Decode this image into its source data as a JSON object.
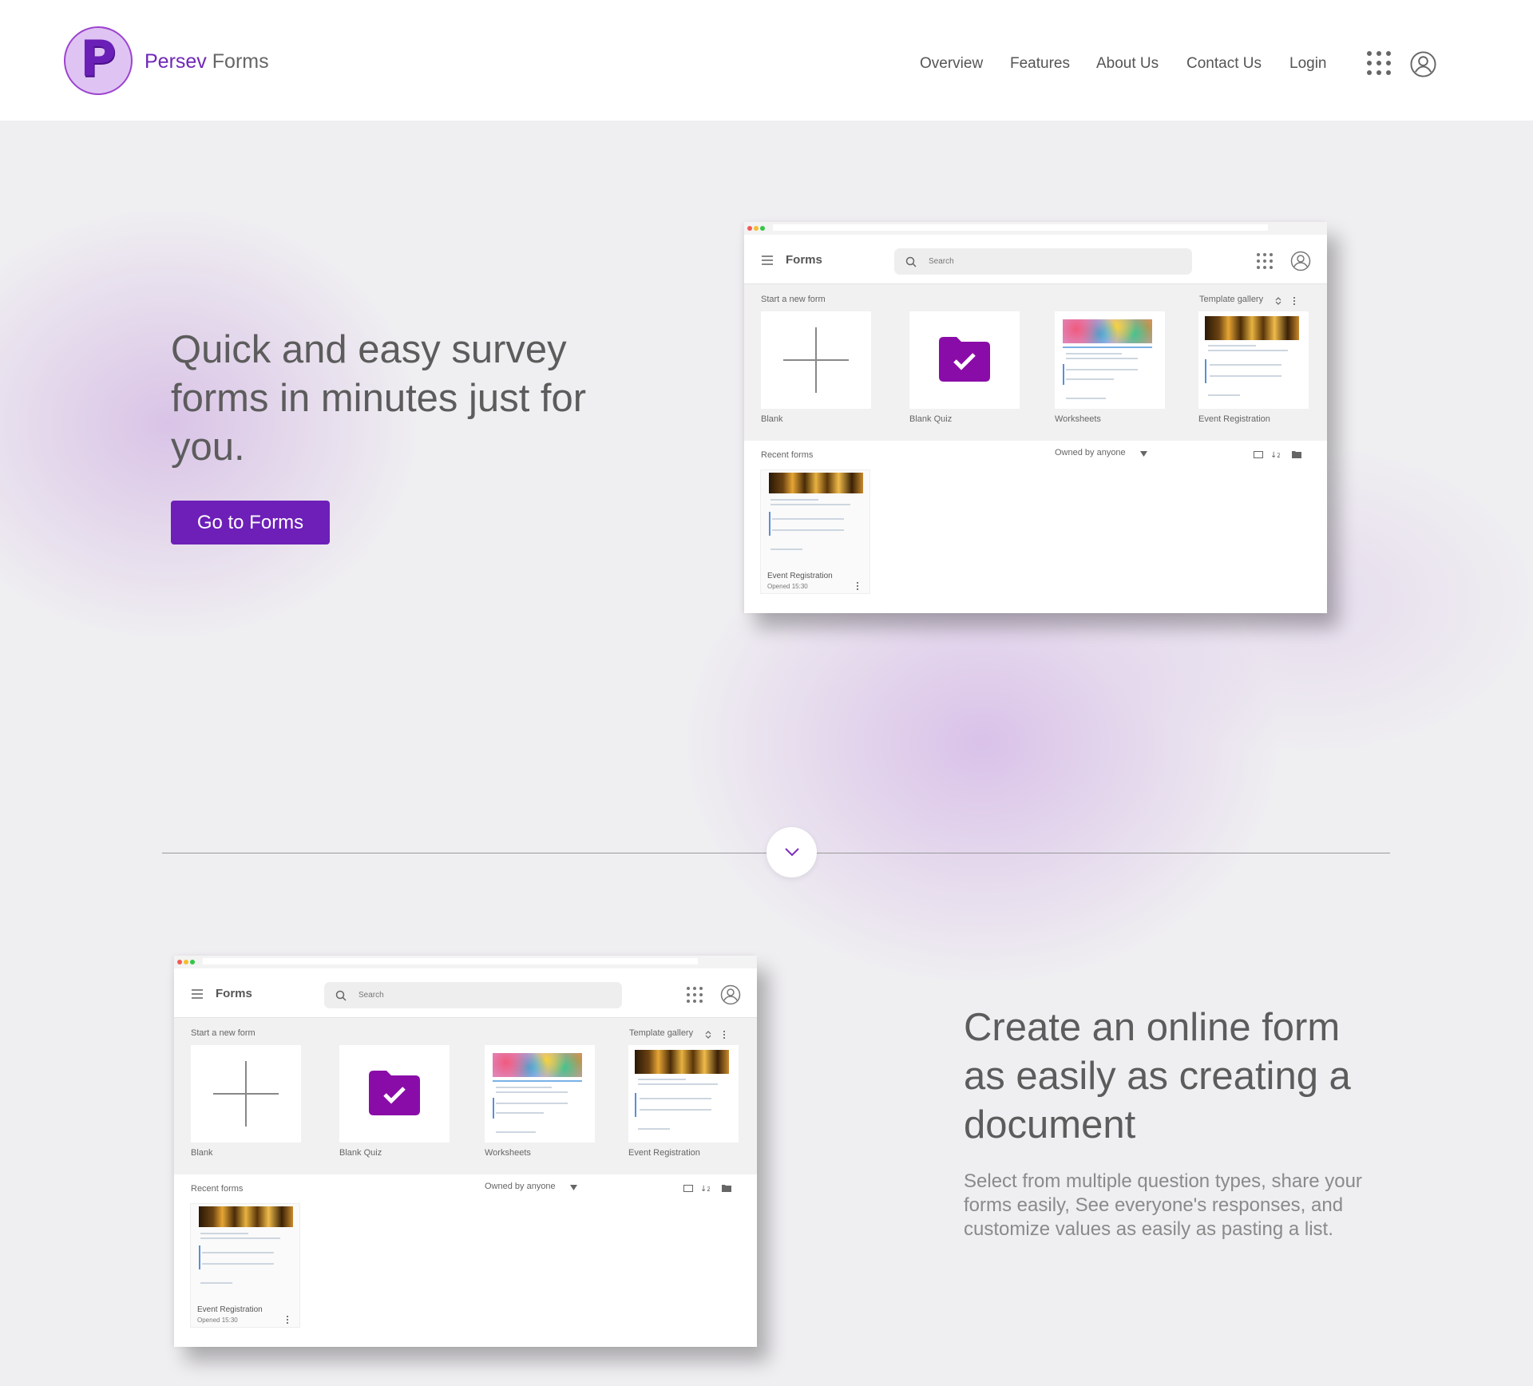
{
  "brand": {
    "logo_letter": "P",
    "name_part1": "Persev",
    "name_part2": "Forms"
  },
  "nav": {
    "overview": "Overview",
    "features": "Features",
    "about": "About Us",
    "contact": "Contact Us",
    "login": "Login"
  },
  "hero": {
    "headline": "Quick and easy survey forms in minutes just for you.",
    "cta": "Go to Forms"
  },
  "section2": {
    "headline": "Create an online form as easily as creating a document",
    "body": "Select from multiple question types, share your forms easily, See everyone's responses, and customize values as easily as pasting a list."
  },
  "mock": {
    "title": "Forms",
    "search_placeholder": "Search",
    "start_new": "Start a new form",
    "template_gallery": "Template gallery",
    "templates": [
      "Blank",
      "Blank Quiz",
      "Worksheets",
      "Event Registration"
    ],
    "recent_forms": "Recent forms",
    "owned_by": "Owned by anyone",
    "recent_card_title": "Event Registration",
    "recent_card_sub": "Opened  15:30"
  },
  "colors": {
    "accent": "#6d1fb8",
    "brand_text": "#6f27b8",
    "logo_bg": "#dfc4f3"
  },
  "icons": [
    "apps-grid-icon",
    "account-circle-icon",
    "chevron-down-icon",
    "menu-icon",
    "search-icon",
    "plus-icon",
    "folder-check-icon",
    "dropdown-arrow-icon",
    "sort-icon",
    "folder-icon",
    "list-view-icon",
    "more-vert-icon"
  ]
}
